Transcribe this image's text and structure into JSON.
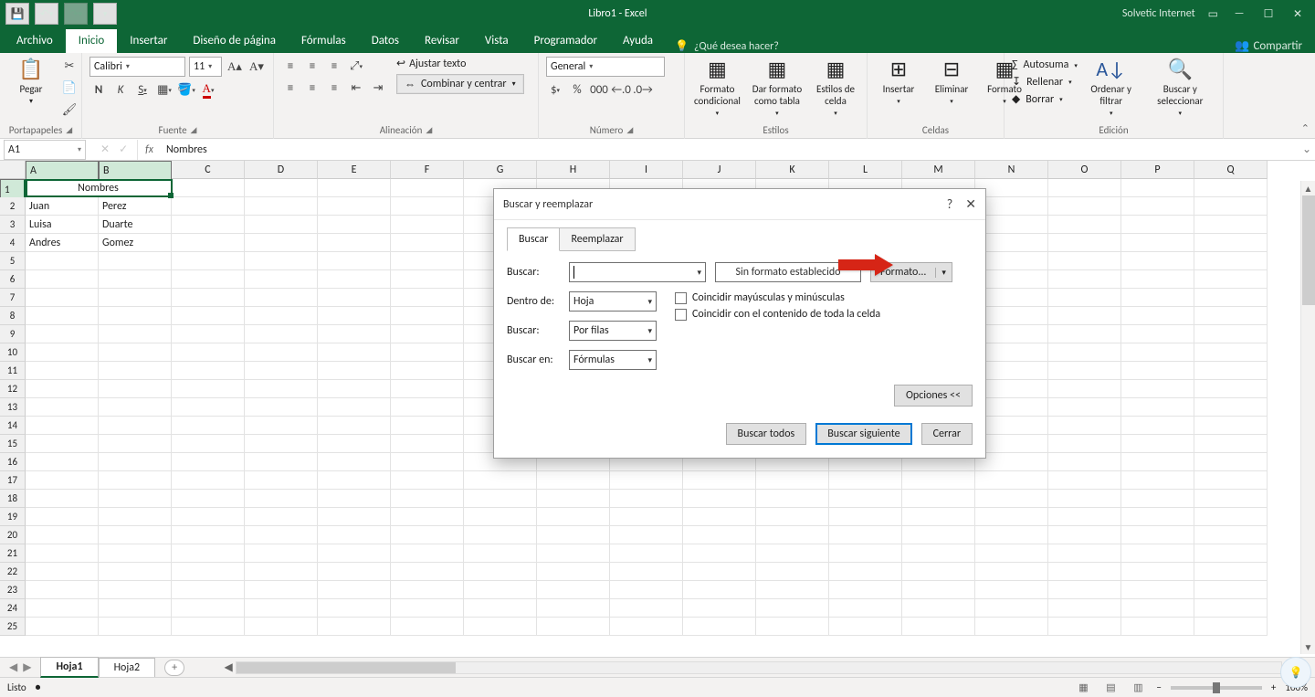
{
  "titlebar": {
    "title": "Libro1 - Excel",
    "user": "Solvetic Internet"
  },
  "tabs": [
    "Archivo",
    "Inicio",
    "Insertar",
    "Diseño de página",
    "Fórmulas",
    "Datos",
    "Revisar",
    "Vista",
    "Programador",
    "Ayuda"
  ],
  "tell_me": "¿Qué desea hacer?",
  "share": "Compartir",
  "groups": {
    "clipboard": {
      "label": "Portapapeles",
      "paste": "Pegar"
    },
    "font": {
      "label": "Fuente",
      "name": "Calibri",
      "size": "11",
      "b": "N",
      "i": "K",
      "u": "S"
    },
    "alignment": {
      "label": "Alineación",
      "wrap": "Ajustar texto",
      "merge": "Combinar y centrar"
    },
    "number": {
      "label": "Número",
      "format": "General"
    },
    "styles": {
      "label": "Estilos",
      "cond": "Formato condicional",
      "table": "Dar formato como tabla",
      "cell": "Estilos de celda"
    },
    "cells": {
      "label": "Celdas",
      "insert": "Insertar",
      "delete": "Eliminar",
      "format": "Formato"
    },
    "editing": {
      "label": "Edición",
      "sum": "Autosuma",
      "fill": "Rellenar",
      "clear": "Borrar",
      "sort": "Ordenar y filtrar",
      "find": "Buscar y seleccionar"
    }
  },
  "namebox": "A1",
  "formula": "Nombres",
  "columns": [
    "A",
    "B",
    "C",
    "D",
    "E",
    "F",
    "G",
    "H",
    "I",
    "J",
    "K",
    "L",
    "M",
    "N",
    "O",
    "P",
    "Q"
  ],
  "rows": 25,
  "cells": {
    "A1": "Nombres",
    "A2": "Juan",
    "B2": "Perez",
    "A3": "Luisa",
    "B3": "Duarte",
    "A4": "Andres",
    "B4": "Gomez"
  },
  "merge": [
    "A1",
    "B1"
  ],
  "sheets": [
    "Hoja1",
    "Hoja2"
  ],
  "active_sheet": "Hoja1",
  "status": {
    "ready": "Listo",
    "zoom": "100%"
  },
  "dialog": {
    "title": "Buscar y reemplazar",
    "tab_find": "Buscar",
    "tab_replace": "Reemplazar",
    "lbl_find": "Buscar:",
    "find_value": "",
    "fmt_preview": "Sin formato establecido",
    "fmt_btn": "Formato...",
    "lbl_within": "Dentro de:",
    "within": "Hoja",
    "lbl_search": "Buscar:",
    "search": "Por filas",
    "lbl_lookin": "Buscar en:",
    "lookin": "Fórmulas",
    "chk_case": "Coincidir mayúsculas y minúsculas",
    "chk_whole": "Coincidir con el contenido de toda la celda",
    "options": "Opciones <<",
    "find_all": "Buscar todos",
    "find_next": "Buscar siguiente",
    "close": "Cerrar"
  }
}
